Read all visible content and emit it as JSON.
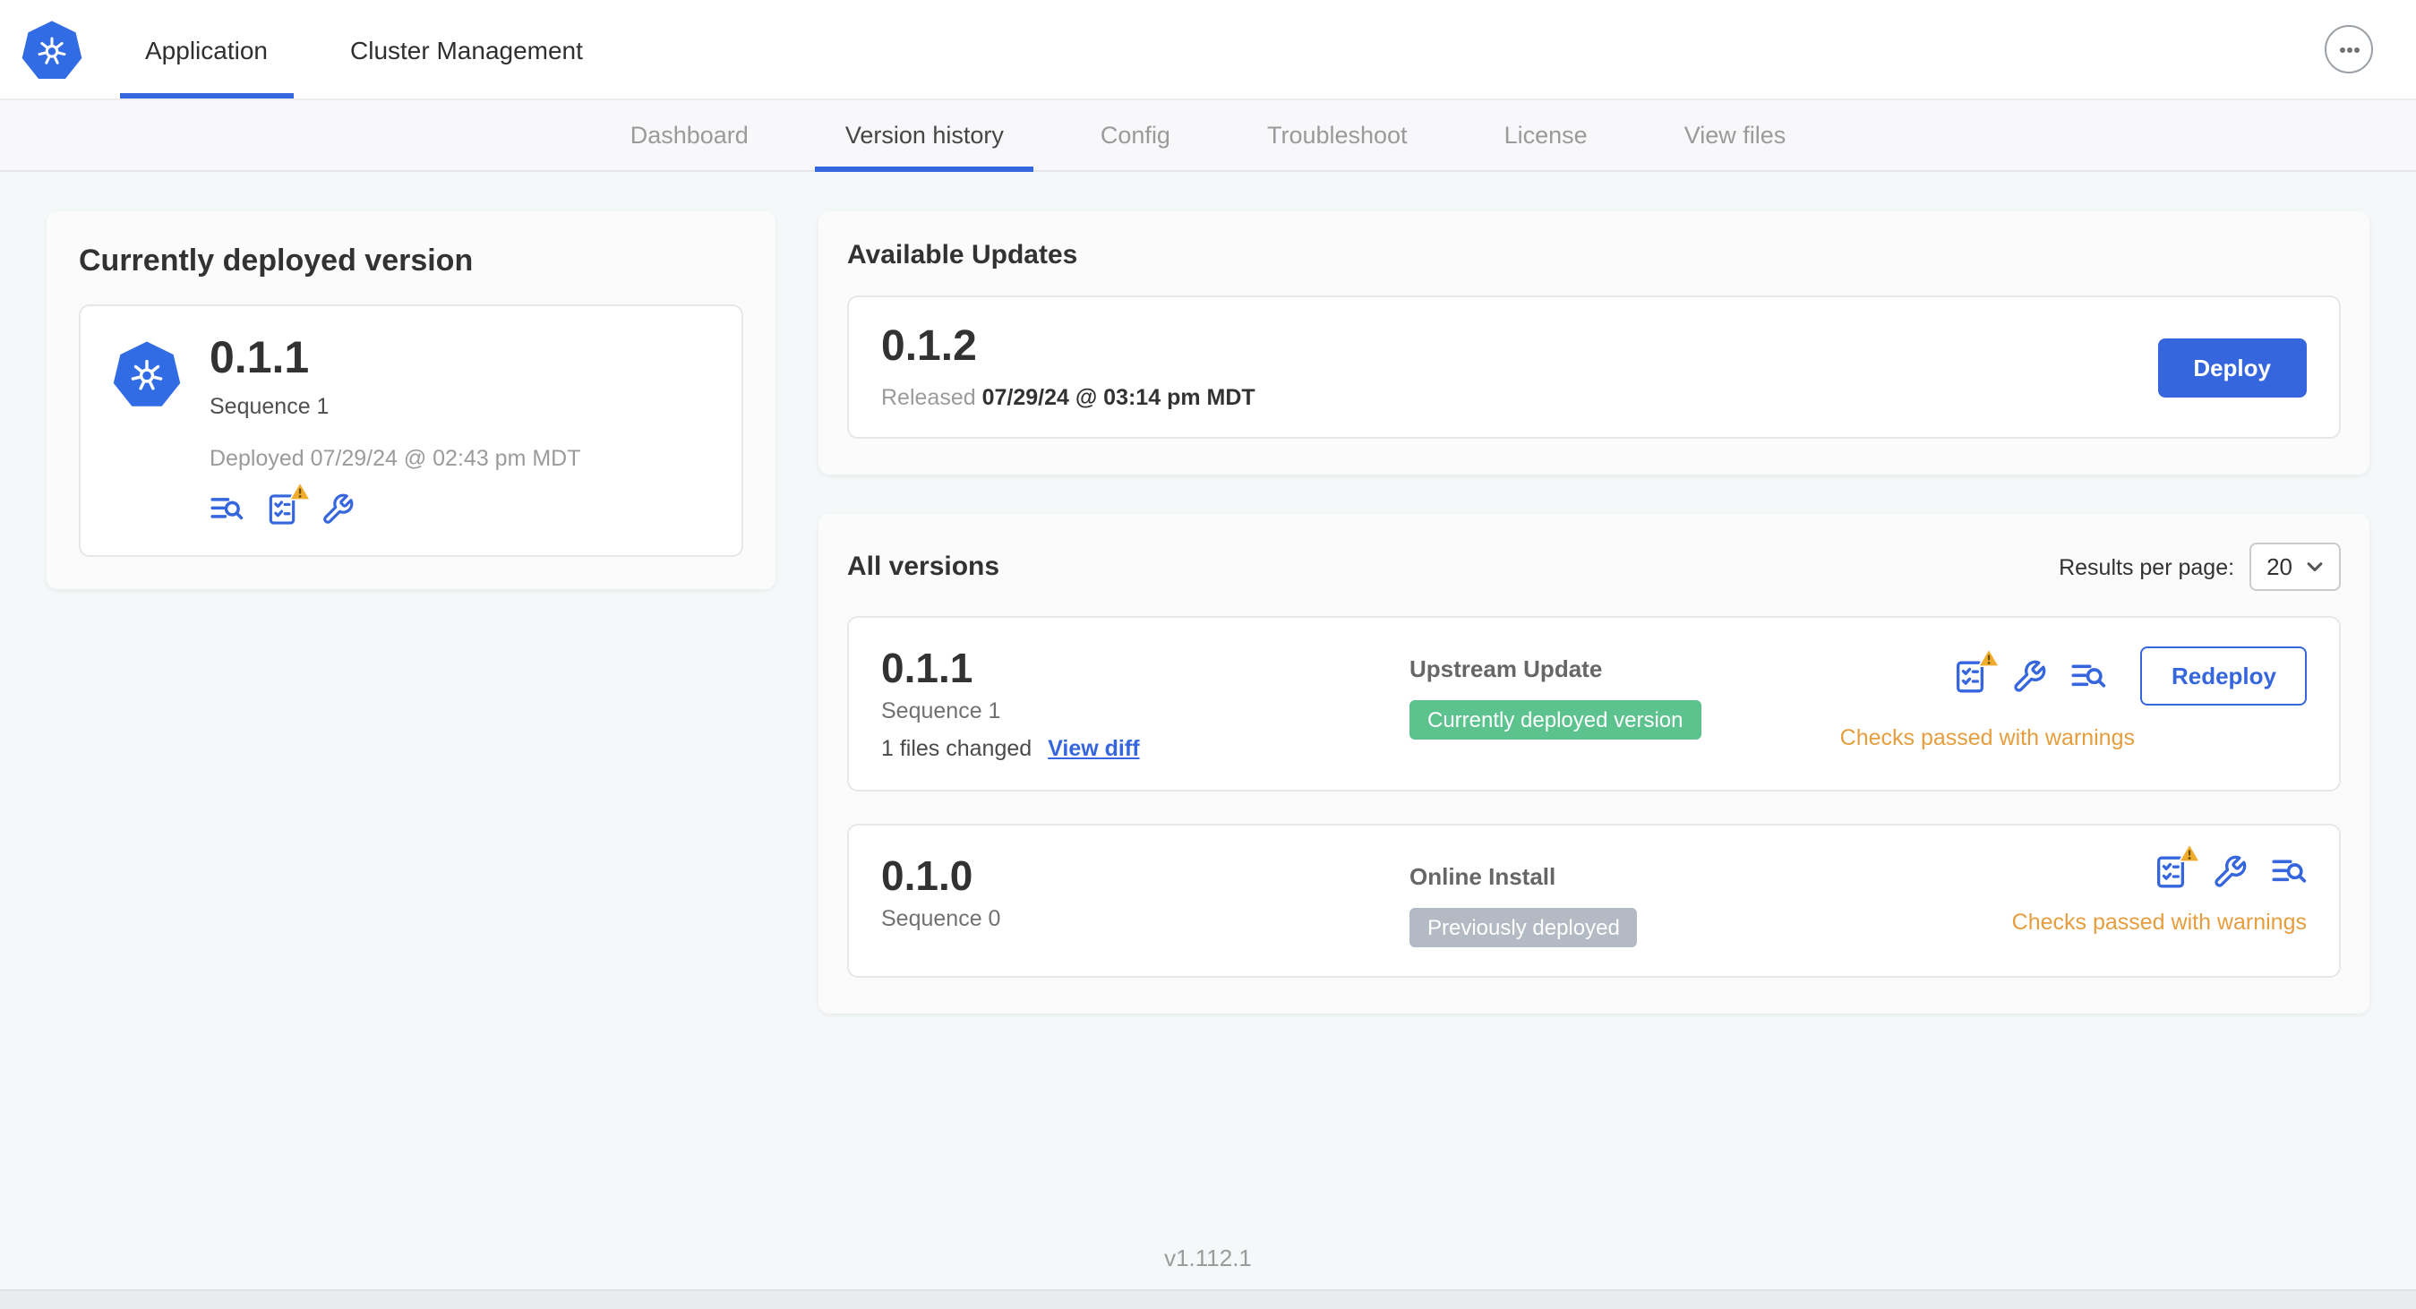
{
  "header": {
    "tabs": [
      {
        "label": "Application",
        "active": true
      },
      {
        "label": "Cluster Management",
        "active": false
      }
    ]
  },
  "subnav": {
    "tabs": [
      "Dashboard",
      "Version history",
      "Config",
      "Troubleshoot",
      "License",
      "View files"
    ],
    "active": "Version history"
  },
  "current_version": {
    "title": "Currently deployed version",
    "version": "0.1.1",
    "sequence": "Sequence 1",
    "deployed": "Deployed 07/29/24 @ 02:43 pm MDT",
    "icons": [
      "logs-icon",
      "preflight-checks-warning-icon",
      "config-wrench-icon"
    ]
  },
  "available_updates": {
    "title": "Available Updates",
    "version": "0.1.2",
    "released_prefix": "Released ",
    "released_date": "07/29/24 @ 03:14 pm MDT",
    "deploy_label": "Deploy"
  },
  "all_versions": {
    "title": "All versions",
    "results_label": "Results per page:",
    "results_value": "20",
    "rows": [
      {
        "version": "0.1.1",
        "sequence": "Sequence 1",
        "files_changed": "1 files changed",
        "view_diff": "View diff",
        "source": "Upstream Update",
        "badge": "Currently deployed version",
        "badge_type": "green",
        "action": "Redeploy",
        "status": "Checks passed with warnings",
        "icons": [
          "preflight-checks-warning-icon",
          "config-wrench-icon",
          "logs-icon"
        ]
      },
      {
        "version": "0.1.0",
        "sequence": "Sequence 0",
        "source": "Online Install",
        "badge": "Previously deployed",
        "badge_type": "gray",
        "status": "Checks passed with warnings",
        "icons": [
          "preflight-checks-warning-icon",
          "config-wrench-icon",
          "logs-icon"
        ]
      }
    ]
  },
  "footer": {
    "version": "v1.112.1"
  },
  "colors": {
    "accent": "#3566dd",
    "kubernetes_blue": "#326ce5",
    "green_badge": "#5cc28e",
    "gray_badge": "#b4bac3",
    "warning_text": "#e69d3d",
    "warning_triangle": "#f0ad2d",
    "page_background": "#f5f8f9"
  }
}
